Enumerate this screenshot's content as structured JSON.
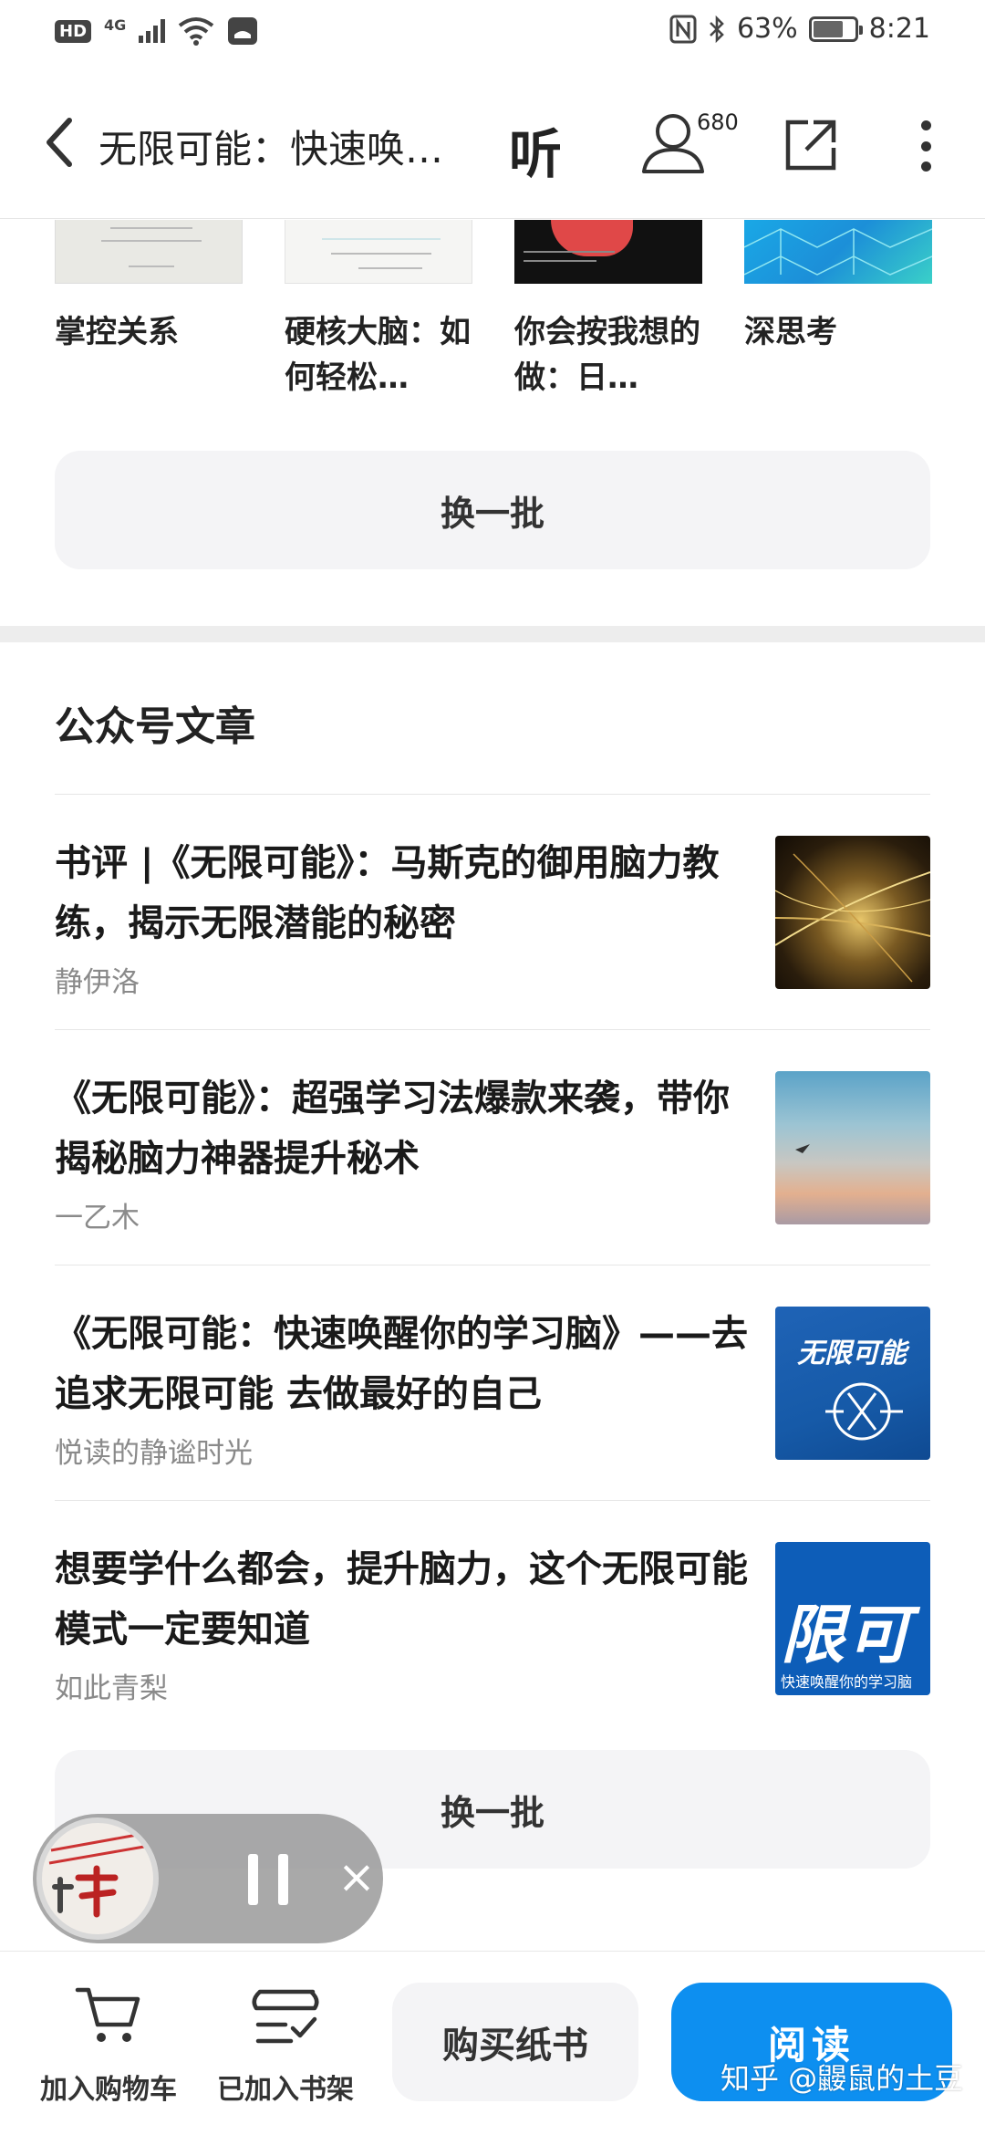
{
  "status_bar": {
    "hd": "HD",
    "network": "4G",
    "battery_percent": "63%",
    "time": "8:21"
  },
  "nav": {
    "title": "无限可能：快速唤…",
    "listen_label": "听",
    "listener_count": "680"
  },
  "books": [
    {
      "title": "掌控关系"
    },
    {
      "title": "硬核大脑：如何轻松…"
    },
    {
      "title": "你会按我想的做：日…"
    },
    {
      "title": "深思考"
    }
  ],
  "refresh_label": "换一批",
  "section": {
    "title": "公众号文章"
  },
  "articles": [
    {
      "title": "书评 |《无限可能》：马斯克的御用脑力教练，揭示无限潜能的秘密",
      "author": "静伊洛"
    },
    {
      "title": "《无限可能》：超强学习法爆款来袭，带你揭秘脑力神器提升秘术",
      "author": "一乙木"
    },
    {
      "title": "《无限可能：快速唤醒你的学习脑》——去追求无限可能 去做最好的自己",
      "author": "悦读的静谧时光",
      "thumb_text": "无限可能"
    },
    {
      "title": "想要学什么都会，提升脑力，这个无限可能模式一定要知道",
      "author": "如此青梨",
      "thumb_text": "限可",
      "thumb_subtext": "快速唤醒你的学习脑"
    }
  ],
  "articles_refresh_label": "换一批",
  "mini_player": {
    "close_symbol": "×"
  },
  "bottom_bar": {
    "cart_label": "加入购物车",
    "shelf_label": "已加入书架",
    "buy_paper_label": "购买纸书",
    "read_label": "阅读"
  },
  "watermark": "知乎 @鼹鼠的土豆",
  "colors": {
    "accent": "#0d8ff0",
    "button_bg": "#f4f4f6",
    "divider": "#ededed"
  }
}
